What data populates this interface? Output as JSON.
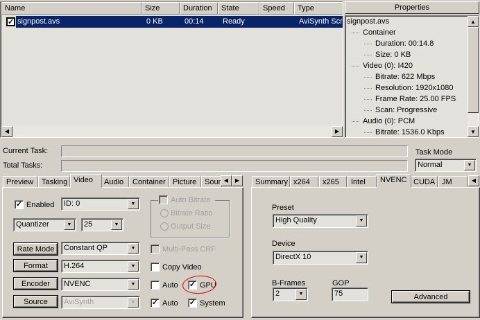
{
  "list": {
    "columns": [
      "Name",
      "Size",
      "Duration",
      "State",
      "Speed",
      "Type"
    ],
    "rows": [
      {
        "checked": true,
        "name": "signpost.avs",
        "size": "0 KB",
        "duration": "00:14",
        "state": "Ready",
        "speed": "",
        "type": "AviSynth Script"
      }
    ]
  },
  "properties": {
    "title": "Properties",
    "tree": [
      {
        "text": "signpost.avs",
        "level": 0
      },
      {
        "text": "Container",
        "level": 1
      },
      {
        "text": "Duration: 00:14.8",
        "level": 2
      },
      {
        "text": "Size: 0 KB",
        "level": 2
      },
      {
        "text": "Video (0): I420",
        "level": 1
      },
      {
        "text": "Bitrate: 622 Mbps",
        "level": 2
      },
      {
        "text": "Resolution: 1920x1080",
        "level": 2
      },
      {
        "text": "Frame Rate: 25.00 FPS",
        "level": 2
      },
      {
        "text": "Scan: Progressive",
        "level": 2
      },
      {
        "text": "Audio (0): PCM",
        "level": 1
      },
      {
        "text": "Bitrate: 1536.0 Kbps",
        "level": 2
      }
    ]
  },
  "status": {
    "current_task_label": "Current Task:",
    "total_tasks_label": "Total Tasks:",
    "task_mode_label": "Task Mode",
    "task_mode_value": "Normal"
  },
  "left_tabs": {
    "tabs": [
      "Preview",
      "Tasking",
      "Video",
      "Audio",
      "Container",
      "Picture",
      "Sour"
    ],
    "active": "Video"
  },
  "video": {
    "enabled_label": "Enabled",
    "enabled": true,
    "id_value": "ID: 0",
    "quantizer_value": "Quantizer",
    "quantizer_num": "25",
    "rate_mode_button": "Rate Mode",
    "rate_mode_value": "Constant QP",
    "format_button": "Format",
    "format_value": "H.264",
    "encoder_button": "Encoder",
    "encoder_value": "NVENC",
    "source_button": "Source",
    "source_value": "AviSynth",
    "auto_bitrate": "Auto Bitrate",
    "bitrate_ratio": "Bitrate Ratio",
    "output_size": "Output Size",
    "multipass_crf": "Multi-Pass CRF",
    "copy_video": "Copy Video",
    "auto1": "Auto",
    "gpu": "GPU",
    "gpu_checked": true,
    "auto2": "Auto",
    "auto2_checked": true,
    "system": "System",
    "system_checked": true,
    "highlight_color": "#e00000"
  },
  "right_tabs": {
    "tabs": [
      "Summary",
      "x264",
      "x265",
      "Intel",
      "NVENC",
      "CUDA",
      "JM"
    ],
    "active": "NVENC"
  },
  "nvenc": {
    "preset_label": "Preset",
    "preset_value": "High Quality",
    "device_label": "Device",
    "device_value": "DirectX 10",
    "bframes_label": "B-Frames",
    "bframes_value": "2",
    "gop_label": "GOP",
    "gop_value": "75",
    "advanced_button": "Advanced"
  },
  "colors": {
    "selection": "#0a246a",
    "background": "#d4d0c8"
  }
}
